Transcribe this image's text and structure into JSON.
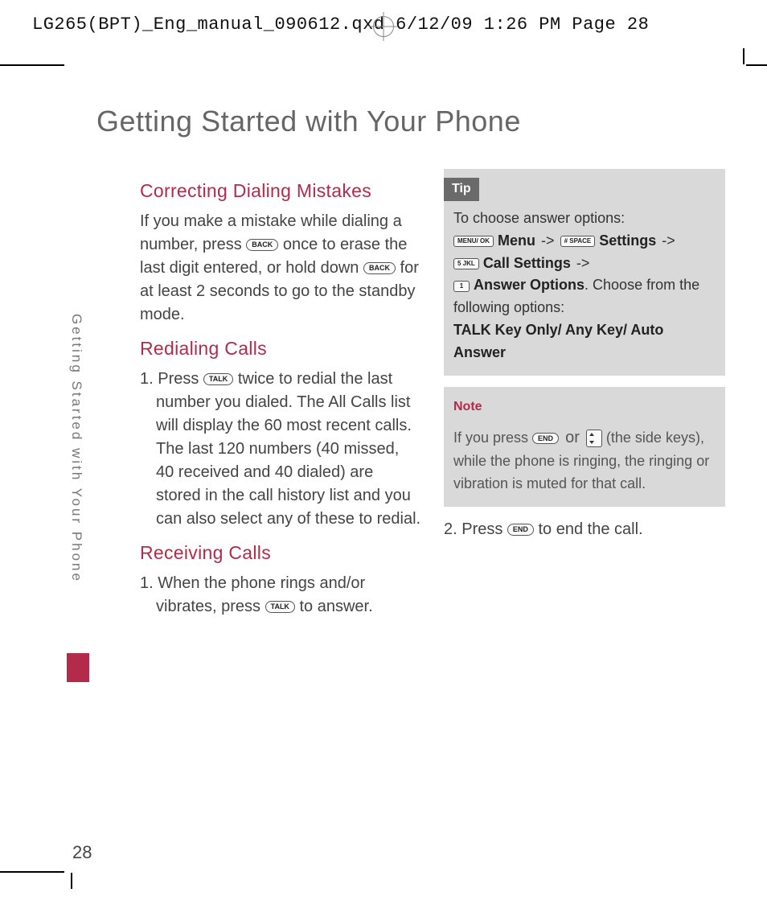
{
  "header_slug": "LG265(BPT)_Eng_manual_090612.qxd  6/12/09  1:26 PM  Page 28",
  "page_title": "Getting Started with Your Phone",
  "sidebar_label": "Getting Started with Your Phone",
  "page_number": "28",
  "keys": {
    "back": "BACK",
    "talk": "TALK",
    "end": "END",
    "menu_ok": "MENU/\nOK",
    "hash": "# SPACE",
    "five": "5 JKL",
    "one": "1"
  },
  "left": {
    "h1": "Correcting Dialing Mistakes",
    "p1a": "If you make a mistake while dialing a number, press ",
    "p1b": " once to erase the last digit entered, or hold down ",
    "p1c": " for at least 2 seconds to go to the standby mode.",
    "h2": "Redialing Calls",
    "s1a": "1. Press ",
    "s1b": " twice to redial the last number you dialed. The All Calls list will display the 60 most recent calls. The last 120 numbers (40 missed, 40 received and 40 dialed) are stored in the call history list and you can also select any of these to redial.",
    "h3": "Receiving Calls",
    "s2a": "1. When the phone rings and/or vibrates, press ",
    "s2b": " to answer."
  },
  "tip": {
    "title": "Tip",
    "line1": "To choose answer options:",
    "menu": "Menu",
    "settings": "Settings",
    "call_settings": "Call Settings",
    "answer_options": "Answer Options",
    "tail": ". Choose from the following options:",
    "opts": "TALK Key Only/ Any Key/ Auto Answer",
    "arrow": "->"
  },
  "note": {
    "title": "Note",
    "a": "If you press ",
    "or": "or",
    "b": " (the side keys), while the phone is ringing, the ringing or vibration is muted for that call."
  },
  "right": {
    "s1a": "2. Press ",
    "s1b": " to end the call."
  }
}
